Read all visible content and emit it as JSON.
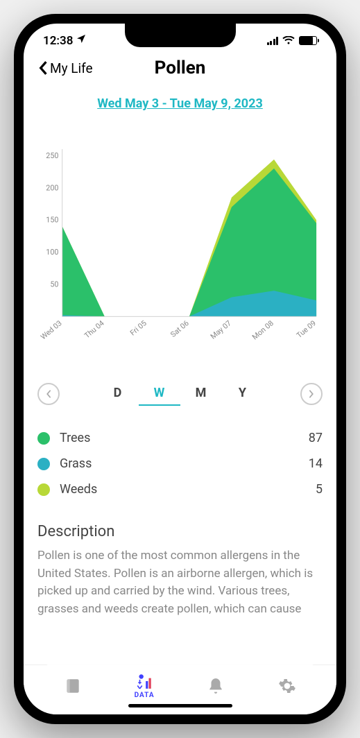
{
  "status": {
    "time": "12:38"
  },
  "header": {
    "back_label": "My Life",
    "title": "Pollen"
  },
  "date_range": "Wed May 3 - Tue May 9, 2023",
  "chart_data": {
    "type": "area",
    "categories": [
      "Wed 03",
      "Thu 04",
      "Fri 05",
      "Sat 06",
      "May 07",
      "Mon 08",
      "Tue 09"
    ],
    "ylim": [
      0,
      260
    ],
    "yticks": [
      50,
      100,
      150,
      200,
      250
    ],
    "series": [
      {
        "name": "Weeds",
        "color": "#b8d837",
        "values": [
          0,
          0,
          0,
          0,
          15,
          14,
          5
        ]
      },
      {
        "name": "Grass",
        "color": "#2bb0c3",
        "values": [
          2,
          0,
          0,
          0,
          30,
          40,
          25
        ]
      },
      {
        "name": "Trees",
        "color": "#2bc06a",
        "values": [
          138,
          0,
          0,
          0,
          140,
          190,
          120
        ]
      }
    ]
  },
  "periods": {
    "options": [
      "D",
      "W",
      "M",
      "Y"
    ],
    "active": "W"
  },
  "legend": [
    {
      "label": "Trees",
      "value": 87,
      "color": "#2bc06a"
    },
    {
      "label": "Grass",
      "value": 14,
      "color": "#2bb0c3"
    },
    {
      "label": "Weeds",
      "value": 5,
      "color": "#b8d837"
    }
  ],
  "description": {
    "heading": "Description",
    "text": "Pollen is one of the most common allergens in the United States. Pollen is an airborne allergen, which is picked up and carried by the wind. Various trees, grasses and weeds create pollen, which can cause"
  },
  "tabbar": {
    "active_label": "DATA"
  }
}
